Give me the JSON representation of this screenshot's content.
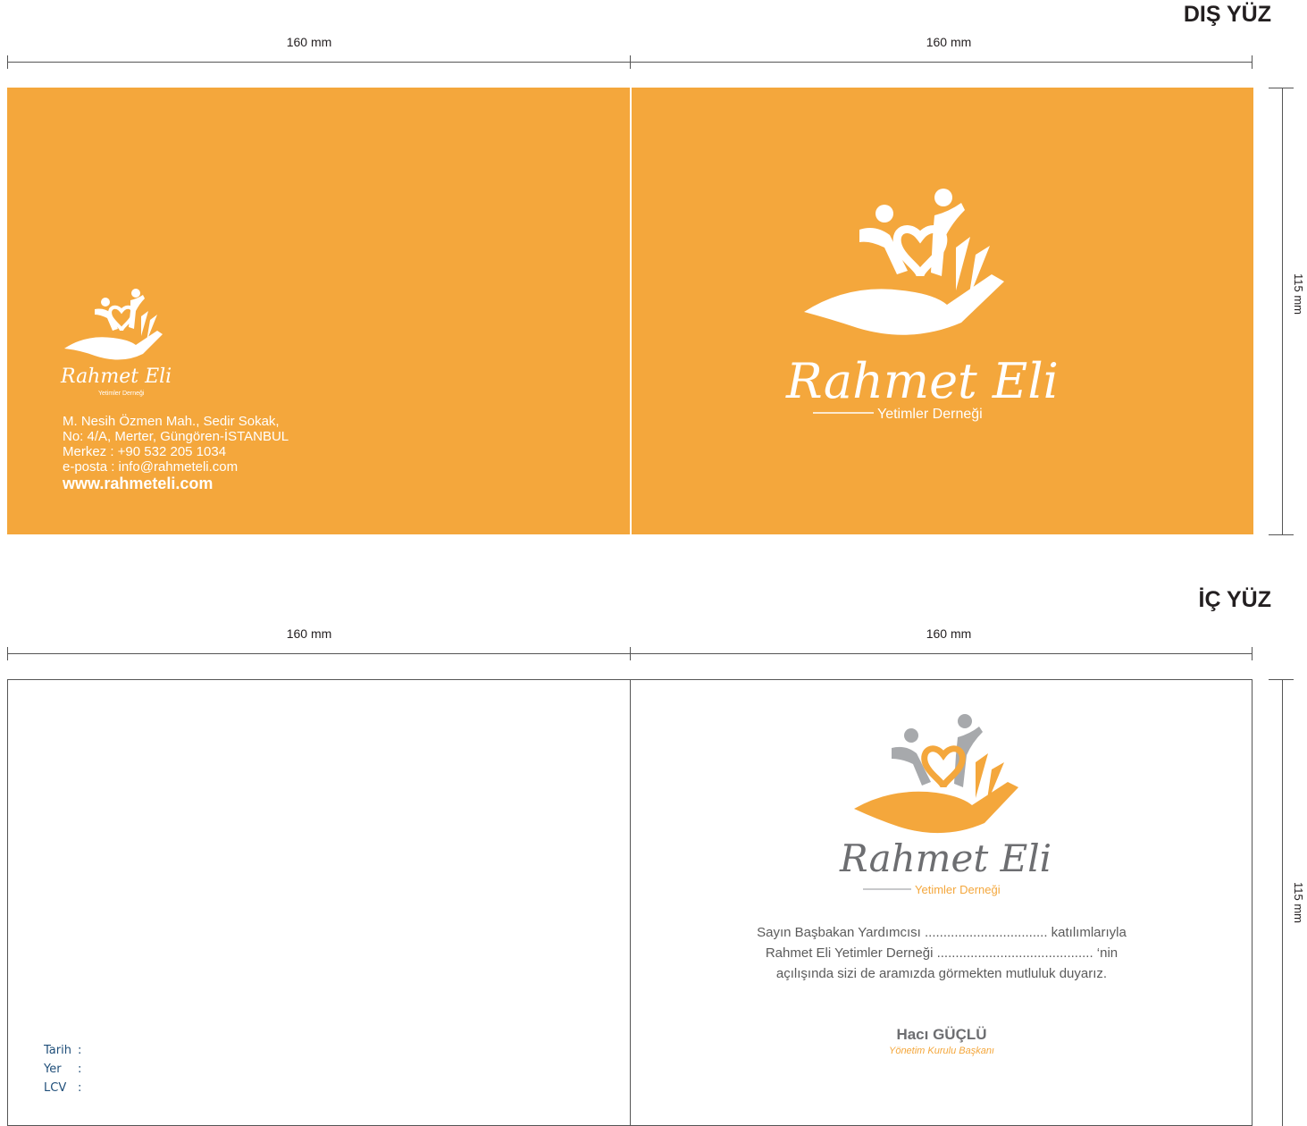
{
  "outer": {
    "title": "DIŞ YÜZ",
    "width_left": "160 mm",
    "width_right": "160 mm",
    "height": "115 mm",
    "brand_script": "Rahmet Eli",
    "brand_sub": "Yetimler Derneği",
    "small_brand_script": "Rahmet Eli",
    "small_brand_sub": "Yetimler Derneği",
    "address_lines": [
      "M. Nesih Özmen Mah., Sedir Sokak,",
      "No: 4/A, Merter, Güngören-İSTANBUL",
      "Merkez : +90 532 205 1034",
      "e-posta : info@rahmeteli.com"
    ],
    "website": "www.rahmeteli.com"
  },
  "inner": {
    "title": "İÇ YÜZ",
    "width_left": "160 mm",
    "width_right": "160 mm",
    "height": "115 mm",
    "brand_script": "Rahmet Eli",
    "brand_sub": "Yetimler Derneği",
    "invitation_lines": [
      "Sayın Başbakan Yardımcısı ................................. katılımlarıyla",
      "Rahmet Eli Yetimler Derneği .......................................... ‘nin",
      "açılışında sizi de aramızda görmekten mutluluk duyarız."
    ],
    "signature_name": "Hacı GÜÇLÜ",
    "signature_title": "Yönetim Kurulu Başkanı",
    "info_labels": [
      "Tarih",
      "Yer",
      "LCV"
    ]
  },
  "colors": {
    "brand_orange": "#f4a73c",
    "logo_gray": "#a7a9ac",
    "text_gray": "#5b5b5b",
    "label_blue": "#1f4e79"
  }
}
